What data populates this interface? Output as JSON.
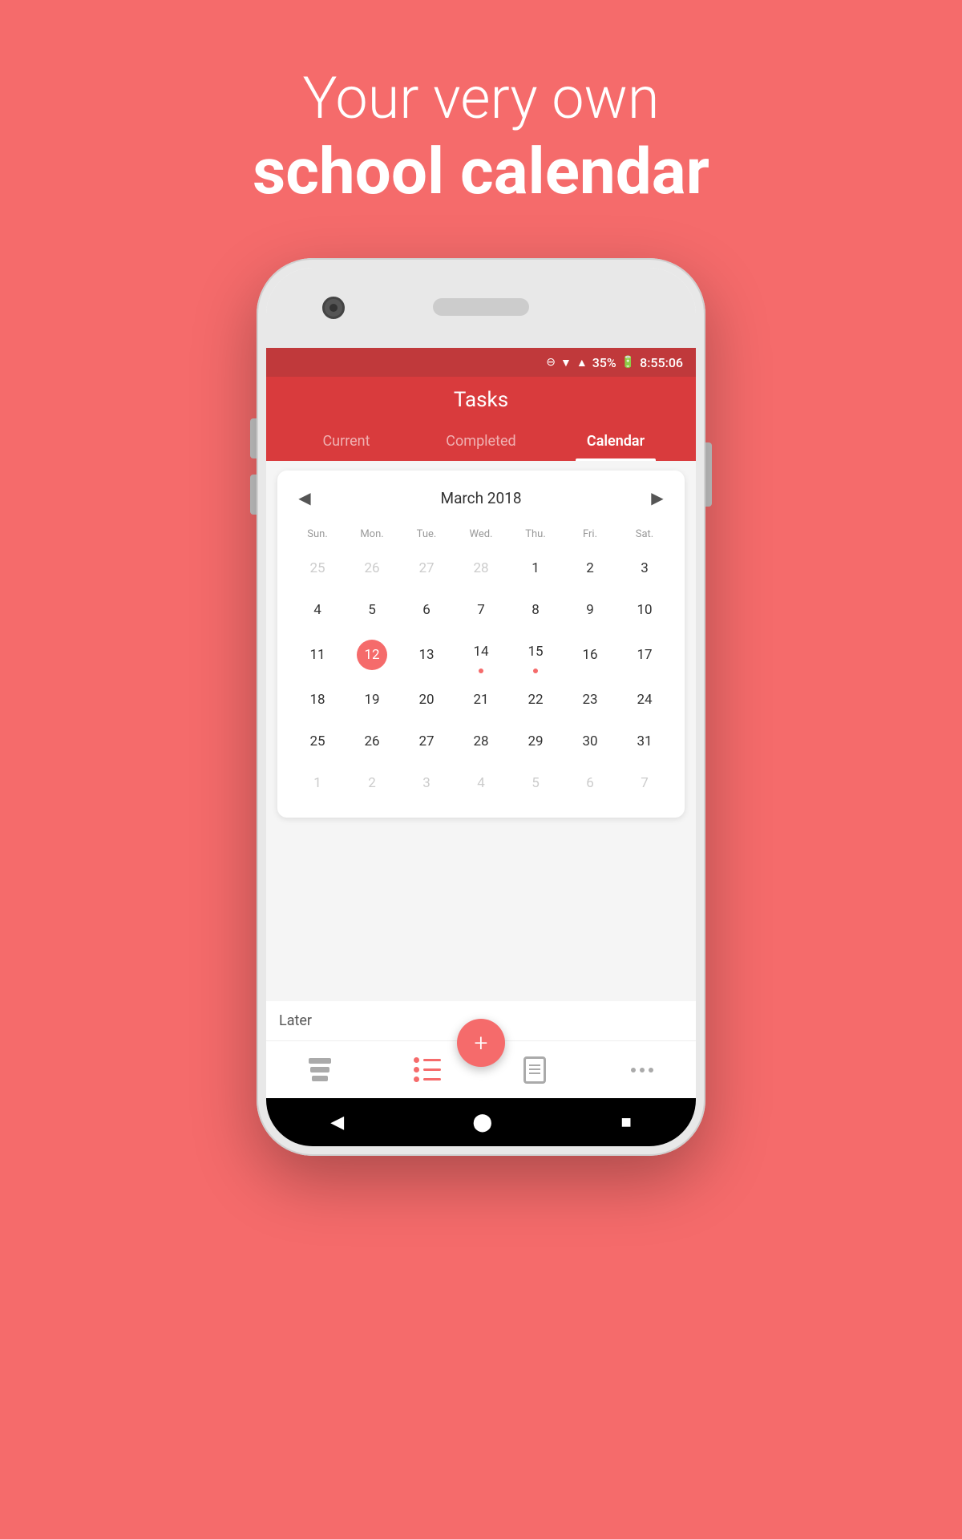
{
  "page": {
    "background_color": "#F56B6B",
    "headline": {
      "line1": "Your very own",
      "line2": "school calendar"
    }
  },
  "status_bar": {
    "battery_percent": "35%",
    "time": "8:55:06"
  },
  "app": {
    "title": "Tasks",
    "tabs": [
      {
        "id": "current",
        "label": "Current",
        "active": false
      },
      {
        "id": "completed",
        "label": "Completed",
        "active": false
      },
      {
        "id": "calendar",
        "label": "Calendar",
        "active": true
      }
    ]
  },
  "calendar": {
    "month_year": "March 2018",
    "day_headers": [
      "Sun.",
      "Mon.",
      "Tue.",
      "Wed.",
      "Thu.",
      "Fri.",
      "Sat."
    ],
    "weeks": [
      [
        {
          "date": "25",
          "type": "other"
        },
        {
          "date": "26",
          "type": "other"
        },
        {
          "date": "27",
          "type": "other"
        },
        {
          "date": "28",
          "type": "other"
        },
        {
          "date": "1",
          "type": "normal"
        },
        {
          "date": "2",
          "type": "normal"
        },
        {
          "date": "3",
          "type": "normal"
        }
      ],
      [
        {
          "date": "4",
          "type": "normal"
        },
        {
          "date": "5",
          "type": "normal"
        },
        {
          "date": "6",
          "type": "normal"
        },
        {
          "date": "7",
          "type": "normal"
        },
        {
          "date": "8",
          "type": "normal"
        },
        {
          "date": "9",
          "type": "normal"
        },
        {
          "date": "10",
          "type": "normal"
        }
      ],
      [
        {
          "date": "11",
          "type": "normal"
        },
        {
          "date": "12",
          "type": "selected"
        },
        {
          "date": "13",
          "type": "normal"
        },
        {
          "date": "14",
          "type": "dot"
        },
        {
          "date": "15",
          "type": "dot"
        },
        {
          "date": "16",
          "type": "normal"
        },
        {
          "date": "17",
          "type": "normal"
        }
      ],
      [
        {
          "date": "18",
          "type": "normal"
        },
        {
          "date": "19",
          "type": "normal"
        },
        {
          "date": "20",
          "type": "normal"
        },
        {
          "date": "21",
          "type": "normal"
        },
        {
          "date": "22",
          "type": "normal"
        },
        {
          "date": "23",
          "type": "normal"
        },
        {
          "date": "24",
          "type": "normal"
        }
      ],
      [
        {
          "date": "25",
          "type": "normal"
        },
        {
          "date": "26",
          "type": "normal"
        },
        {
          "date": "27",
          "type": "normal"
        },
        {
          "date": "28",
          "type": "normal"
        },
        {
          "date": "29",
          "type": "normal"
        },
        {
          "date": "30",
          "type": "normal"
        },
        {
          "date": "31",
          "type": "normal"
        }
      ],
      [
        {
          "date": "1",
          "type": "other"
        },
        {
          "date": "2",
          "type": "other"
        },
        {
          "date": "3",
          "type": "other"
        },
        {
          "date": "4",
          "type": "other"
        },
        {
          "date": "5",
          "type": "other"
        },
        {
          "date": "6",
          "type": "other"
        },
        {
          "date": "7",
          "type": "other"
        }
      ]
    ]
  },
  "bottom": {
    "section_label": "Later",
    "fab_label": "+"
  },
  "nav": {
    "back": "◀",
    "home": "⬤",
    "recent": "■"
  }
}
